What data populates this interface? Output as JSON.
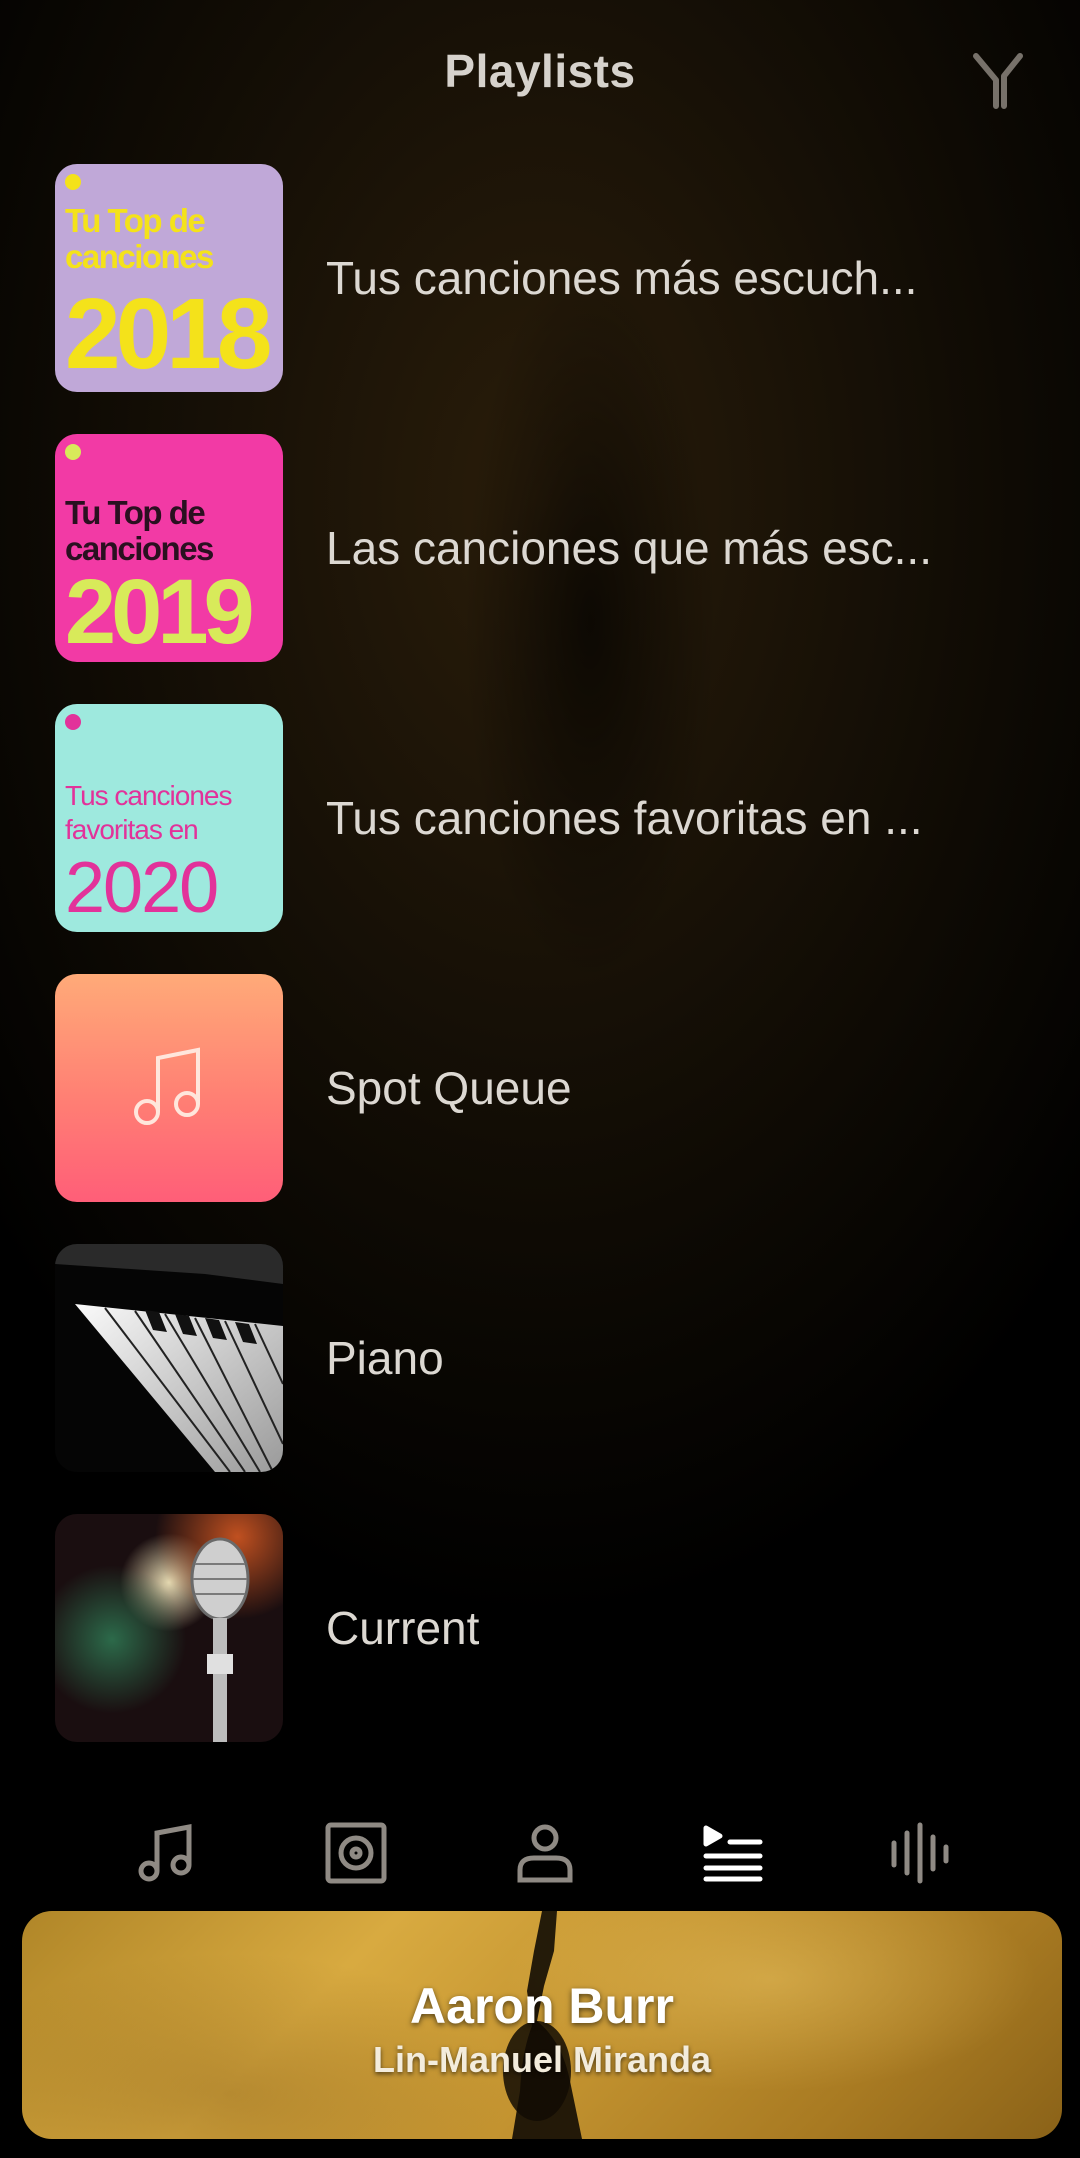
{
  "header": {
    "title": "Playlists",
    "filter_icon": "filter-y-icon"
  },
  "playlists": [
    {
      "label": "Tus canciones más escuch...",
      "cover": {
        "line1": "Tu Top de",
        "line2": "canciones",
        "year": "2018",
        "bg": "#c0a8d8",
        "fg": "#f4e21a"
      }
    },
    {
      "label": "Las canciones que más esc...",
      "cover": {
        "line1": "Tu Top de",
        "line2": "canciones",
        "year": "2019",
        "bg": "#f23aa5",
        "fg": "#d8ea5a",
        "line_fg": "#2a1020"
      }
    },
    {
      "label": "Tus canciones favoritas en ...",
      "cover": {
        "line1": "Tus canciones",
        "line2": "favoritas en",
        "year": "2020",
        "bg": "#9ee9de",
        "fg": "#e2329a"
      }
    },
    {
      "label": "Spot Queue",
      "cover": {
        "icon": "music-note-icon"
      }
    },
    {
      "label": "Piano",
      "cover": {
        "icon": "piano-keys-image"
      }
    },
    {
      "label": "Current",
      "cover": {
        "icon": "microphone-image"
      }
    }
  ],
  "tabs": [
    {
      "name": "songs-tab",
      "icon": "music-note-icon",
      "active": false
    },
    {
      "name": "albums-tab",
      "icon": "disc-icon",
      "active": false
    },
    {
      "name": "artists-tab",
      "icon": "person-icon",
      "active": false
    },
    {
      "name": "playlists-tab",
      "icon": "playlist-icon",
      "active": true
    },
    {
      "name": "equalizer-tab",
      "icon": "waveform-icon",
      "active": false
    }
  ],
  "now_playing": {
    "title": "Aaron Burr",
    "artist": "Lin-Manuel Miranda"
  },
  "colors": {
    "text": "#dcd8d2",
    "inactive_icon": "#8f8a84",
    "active_icon": "#ffffff",
    "accent_gold": "#c9972f"
  }
}
